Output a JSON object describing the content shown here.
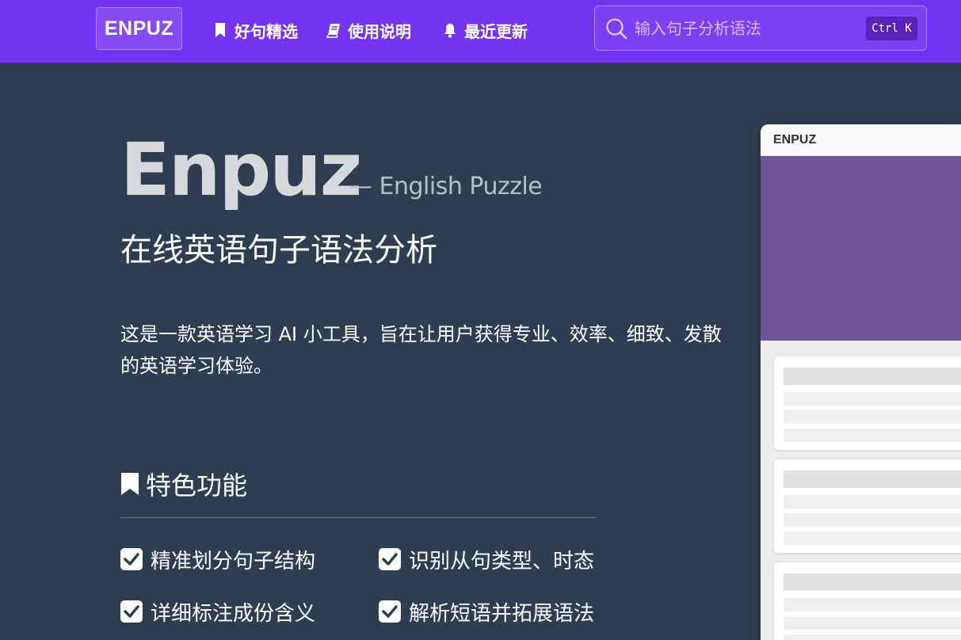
{
  "navbar": {
    "brand": "ENPUZ",
    "items": [
      {
        "label": "好句精选",
        "icon": "bookmark-icon"
      },
      {
        "label": "使用说明",
        "icon": "book-icon"
      },
      {
        "label": "最近更新",
        "icon": "bell-icon"
      }
    ],
    "search": {
      "placeholder": "输入句子分析语法",
      "value": "",
      "shortcut": "Ctrl K",
      "icon": "search-icon"
    }
  },
  "hero": {
    "title": "Enpuz",
    "subtitle": "— English Puzzle",
    "tagline": "在线英语句子语法分析",
    "description": "这是一款英语学习 AI 小工具，旨在让用户获得专业、效率、细致、发散的英语学习体验。"
  },
  "features": {
    "title": "特色功能",
    "icon": "bookmark-icon",
    "items": [
      "精准划分句子结构",
      "识别从句类型、时态",
      "详细标注成份含义",
      "解析短语并拓展语法"
    ]
  },
  "preview": {
    "window_title": "ENPUZ"
  },
  "colors": {
    "navbar": "#7434f1",
    "background": "#2e3e50",
    "preview_banner": "#6e5596"
  }
}
